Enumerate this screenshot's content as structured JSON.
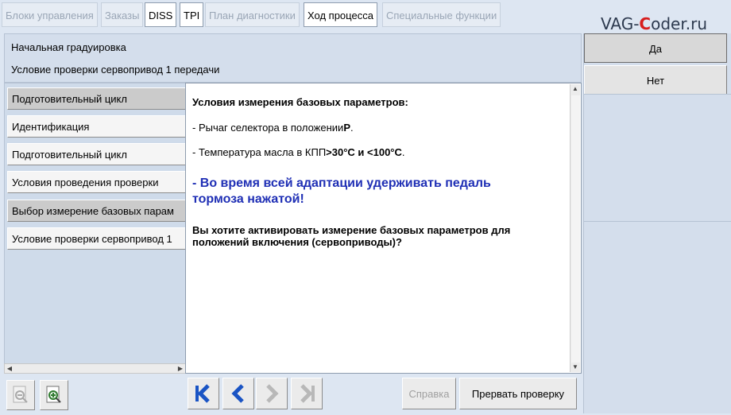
{
  "tabs": [
    {
      "label": "Блоки управления",
      "active": false
    },
    {
      "label": "Заказы",
      "active": false
    },
    {
      "label": "DISS",
      "active": true
    },
    {
      "label": "TPI",
      "active": true
    },
    {
      "label": "План диагностики",
      "active": false
    },
    {
      "label": "Ход процесса",
      "active": true
    },
    {
      "label": "Специальные функции",
      "active": false
    }
  ],
  "watermark": {
    "prefix": "VAG-",
    "highlight": "C",
    "suffix": "oder.ru"
  },
  "header": {
    "title": "Начальная градуировка",
    "subtitle": "Условие проверки сервопривод 1 передачи"
  },
  "steps": [
    "Подготовительный цикл",
    "Идентификация",
    "Подготовительный цикл",
    "Условия проведения проверки",
    "Выбор измерение базовых парам",
    "Условие проверки сервопривод 1"
  ],
  "content": {
    "heading": "Условия измерения базовых параметров:",
    "line1_prefix": "- Рычаг селектора в положении",
    "line1_value": "P",
    "line1_suffix": ".",
    "line2_prefix": "- Температура масла в КПП",
    "line2_value": ">30°C  и <100°C",
    "line2_suffix": ".",
    "warning": "- Во время всей адаптации удерживать педаль тормоза нажатой!",
    "question": "Вы хотите активировать измерение базовых параметров для положений включения (сервоприводы)?"
  },
  "right_buttons": {
    "yes": "Да",
    "no": "Нет"
  },
  "toolbar": {
    "help_label": "Справка",
    "abort_label": "Прервать проверку"
  },
  "colors": {
    "nav_blue": "#1a54c4",
    "warning_blue": "#1f2fb5",
    "panel_bg": "#dde6f2"
  }
}
